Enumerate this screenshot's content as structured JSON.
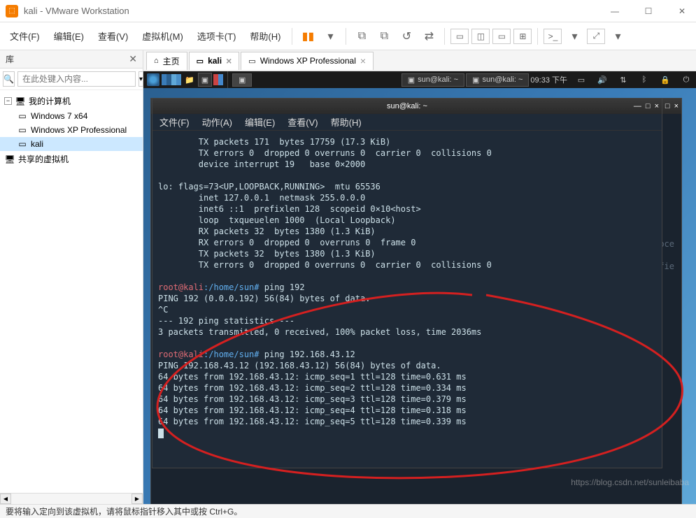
{
  "window": {
    "title": "kali - VMware Workstation"
  },
  "menubar": {
    "items": [
      "文件(F)",
      "编辑(E)",
      "查看(V)",
      "虚拟机(M)",
      "选项卡(T)",
      "帮助(H)"
    ]
  },
  "sidebar": {
    "title": "库",
    "search_placeholder": "在此处键入内容...",
    "tree": {
      "root": "我的计算机",
      "items": [
        "Windows 7 x64",
        "Windows XP Professional",
        "kali"
      ],
      "shared": "共享的虚拟机"
    }
  },
  "tabs": {
    "home": "主页",
    "kali": "kali",
    "winxp": "Windows XP Professional"
  },
  "kali_taskbar": {
    "task1": "sun@kali: ~",
    "task2": "sun@kali: ~",
    "time": "09:33 下午"
  },
  "terminal": {
    "title": "sun@kali: ~",
    "menu": [
      "文件(F)",
      "动作(A)",
      "编辑(E)",
      "查看(V)",
      "帮助(H)"
    ],
    "lines": {
      "l1": "        TX packets 171  bytes 17759 (17.3 KiB)",
      "l2": "        TX errors 0  dropped 0 overruns 0  carrier 0  collisions 0",
      "l3": "        device interrupt 19   base 0×2000",
      "l4": "",
      "l5": "lo: flags=73<UP,LOOPBACK,RUNNING>  mtu 65536",
      "l6": "        inet 127.0.0.1  netmask 255.0.0.0",
      "l7": "        inet6 ::1  prefixlen 128  scopeid 0×10<host>",
      "l8": "        loop  txqueuelen 1000  (Local Loopback)",
      "l9": "        RX packets 32  bytes 1380 (1.3 KiB)",
      "l10": "        RX errors 0  dropped 0  overruns 0  frame 0",
      "l11": "        TX packets 32  bytes 1380 (1.3 KiB)",
      "l12": "        TX errors 0  dropped 0 overruns 0  carrier 0  collisions 0",
      "l13": "",
      "p1_user": "root@kali",
      "p1_path": ":/home/sun#",
      "p1_cmd": " ping 192",
      "l15": "PING 192 (0.0.0.192) 56(84) bytes of data.",
      "l16": "^C",
      "l17": "--- 192 ping statistics ---",
      "l18": "3 packets transmitted, 0 received, 100% packet loss, time 2036ms",
      "l19": "",
      "p2_user": "root@kali",
      "p2_path": ":/home/sun#",
      "p2_cmd": " ping 192.168.43.12",
      "l21": "PING 192.168.43.12 (192.168.43.12) 56(84) bytes of data.",
      "l22": "64 bytes from 192.168.43.12: icmp_seq=1 ttl=128 time=0.631 ms",
      "l23": "64 bytes from 192.168.43.12: icmp_seq=2 ttl=128 time=0.334 ms",
      "l24": "64 bytes from 192.168.43.12: icmp_seq=3 ttl=128 time=0.379 ms",
      "l25": "64 bytes from 192.168.43.12: icmp_seq=4 ttl=128 time=0.318 ms",
      "l26": "64 bytes from 192.168.43.12: icmp_seq=5 ttl=128 time=0.339 ms"
    },
    "bg_hints": {
      "h1": "ad, proce",
      "h2": "specifie"
    }
  },
  "statusbar": {
    "text": "要将输入定向到该虚拟机，请将鼠标指针移入其中或按 Ctrl+G。"
  },
  "watermark": "https://blog.csdn.net/sunleibaba"
}
